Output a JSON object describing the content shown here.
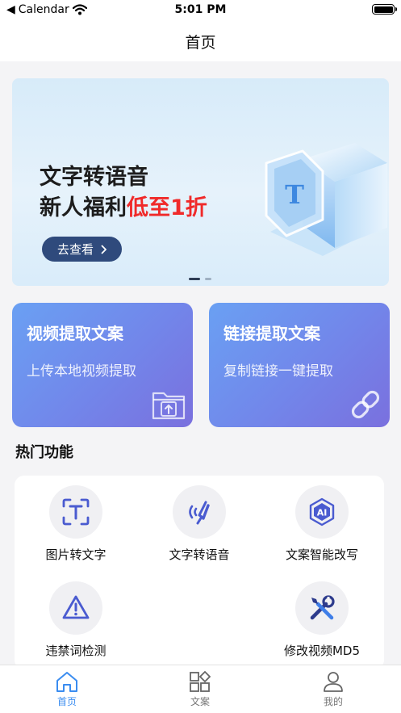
{
  "status_bar": {
    "back_app": "Calendar",
    "time": "5:01 PM"
  },
  "nav": {
    "title": "首页"
  },
  "banner": {
    "line1": "文字转语音",
    "line2_prefix": "新人福利",
    "line2_highlight": "低至1折",
    "button_label": "去查看",
    "art_letter": "T",
    "highlight_color": "#f02a2a",
    "page_count": 2,
    "active_page": 1
  },
  "feature_cards": [
    {
      "title": "视频提取文案",
      "subtitle": "上传本地视频提取",
      "icon": "folder-upload-icon"
    },
    {
      "title": "链接提取文案",
      "subtitle": "复制链接一键提取",
      "icon": "link-icon"
    }
  ],
  "hot_section": {
    "title": "热门功能",
    "items": [
      {
        "label": "图片转文字",
        "icon": "text-scan-icon"
      },
      {
        "label": "文字转语音",
        "icon": "voice-wave-icon"
      },
      {
        "label": "文案智能改写",
        "icon": "ai-chip-icon"
      },
      {
        "label": "违禁词检测",
        "icon": "warning-icon"
      },
      {
        "label": "修改视频MD5",
        "icon": "tools-icon"
      }
    ]
  },
  "tabbar": {
    "tabs": [
      {
        "label": "首页",
        "icon": "home-icon",
        "active": true
      },
      {
        "label": "文案",
        "icon": "grid-icon",
        "active": false
      },
      {
        "label": "我的",
        "icon": "user-icon",
        "active": false
      }
    ]
  },
  "colors": {
    "accent": "#3a8cf0",
    "icon_blue": "#4a5bd0",
    "card_gradient_start": "#6aa0f3",
    "card_gradient_end": "#7a70de"
  }
}
